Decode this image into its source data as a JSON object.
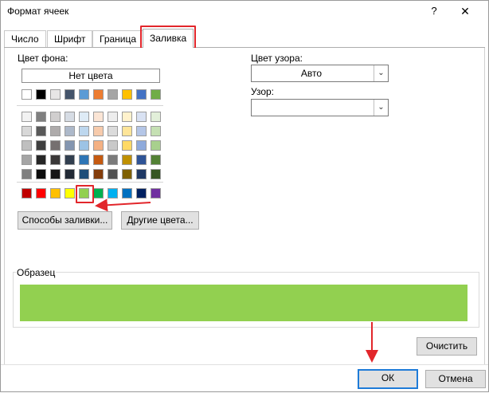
{
  "window": {
    "title": "Формат ячеек",
    "help_label": "?",
    "close_label": "✕"
  },
  "tabs": [
    {
      "label": "Число"
    },
    {
      "label": "Шрифт"
    },
    {
      "label": "Граница"
    },
    {
      "label": "Заливка",
      "active": true
    }
  ],
  "fill": {
    "background_label": "Цвет фона:",
    "no_color_label": "Нет цвета",
    "fill_effects_label": "Способы заливки...",
    "more_colors_label": "Другие цвета..."
  },
  "pattern": {
    "color_label": "Цвет узора:",
    "color_value": "Авто",
    "style_label": "Узор:",
    "style_value": ""
  },
  "palette": {
    "theme_row": [
      "#ffffff",
      "#000000",
      "#e7e6e6",
      "#44546a",
      "#5b9bd5",
      "#ed7d31",
      "#a5a5a5",
      "#ffc000",
      "#4472c4",
      "#70ad47"
    ],
    "tint_rows": [
      [
        "#f2f2f2",
        "#7f7f7f",
        "#d0cece",
        "#d6dce4",
        "#deebf6",
        "#fbe5d5",
        "#ededed",
        "#fff2cc",
        "#d9e2f3",
        "#e2efd9"
      ],
      [
        "#d8d8d8",
        "#595959",
        "#aeabab",
        "#adb9ca",
        "#bdd7ee",
        "#f7cbac",
        "#dbdbdb",
        "#fee599",
        "#b4c6e7",
        "#c5e0b3"
      ],
      [
        "#bfbfbf",
        "#3f3f3f",
        "#757070",
        "#8496b0",
        "#9cc3e5",
        "#f4b183",
        "#c9c9c9",
        "#ffd965",
        "#8eaadb",
        "#a8d08d"
      ],
      [
        "#a5a5a5",
        "#262626",
        "#3a3838",
        "#323f4f",
        "#2e75b5",
        "#c55a11",
        "#7b7b7b",
        "#bf9000",
        "#2f5496",
        "#538135"
      ],
      [
        "#7f7f7f",
        "#0c0c0c",
        "#171616",
        "#222a35",
        "#1e4e79",
        "#833c0b",
        "#525252",
        "#7f6000",
        "#1f3864",
        "#375623"
      ]
    ],
    "standard_row": [
      "#c00000",
      "#ff0000",
      "#ffc000",
      "#ffff00",
      "#92d050",
      "#00b050",
      "#00b0f0",
      "#0070c0",
      "#002060",
      "#7030a0"
    ],
    "selected_color": "#92d050"
  },
  "sample": {
    "legend": "Образец",
    "color": "#92d050"
  },
  "buttons": {
    "clear_label": "Очистить",
    "ok_label": "ОК",
    "cancel_label": "Отмена"
  },
  "colors": {
    "highlight": "#e2262b",
    "focus": "#1e7bd8"
  }
}
